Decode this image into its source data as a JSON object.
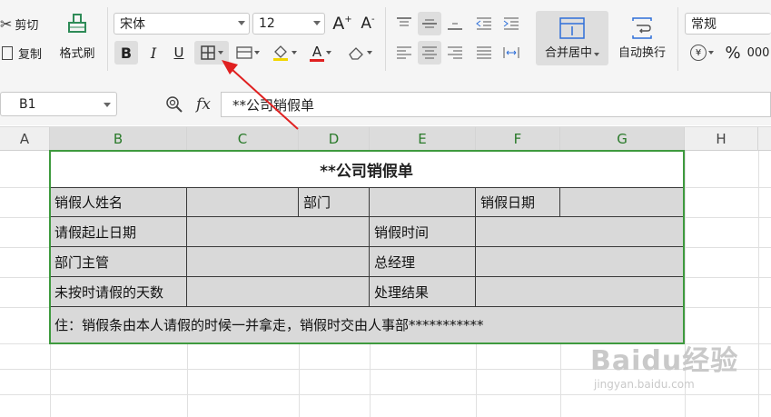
{
  "ribbon": {
    "cut_label": "剪切",
    "copy_label": "复制",
    "format_painter_label": "格式刷",
    "font_name": "宋体",
    "font_size": "12",
    "grow_font": "A",
    "shrink_font": "A",
    "bold": "B",
    "italic": "I",
    "underline": "U",
    "font_color_glyph": "A",
    "merge_center_label": "合并居中",
    "wrap_text_label": "自动换行",
    "number_format": "常规",
    "percent": "%",
    "thousands": "000"
  },
  "formula_bar": {
    "cell_ref": "B1",
    "fx": "fx",
    "content": "**公司销假单"
  },
  "columns": [
    "A",
    "B",
    "C",
    "D",
    "E",
    "F",
    "G",
    "H"
  ],
  "form": {
    "title": "**公司销假单",
    "row1": {
      "name_label": "销假人姓名",
      "dept_label": "部门",
      "date_label": "销假日期"
    },
    "row2": {
      "range_label": "请假起止日期",
      "time_label": "销假时间"
    },
    "row3": {
      "supervisor_label": "部门主管",
      "gm_label": "总经理"
    },
    "row4": {
      "overdue_label": "未按时请假的天数",
      "result_label": "处理结果"
    },
    "note": "住：销假条由本人请假的时候一并拿走，销假时交由人事部***********"
  },
  "watermark": {
    "text": "Baidu经验",
    "sub": "jingyan.baidu.com"
  },
  "colors": {
    "selection": "#3e9a3e",
    "annotation_arrow": "#e02020",
    "table_fill": "#d9d9d9"
  }
}
